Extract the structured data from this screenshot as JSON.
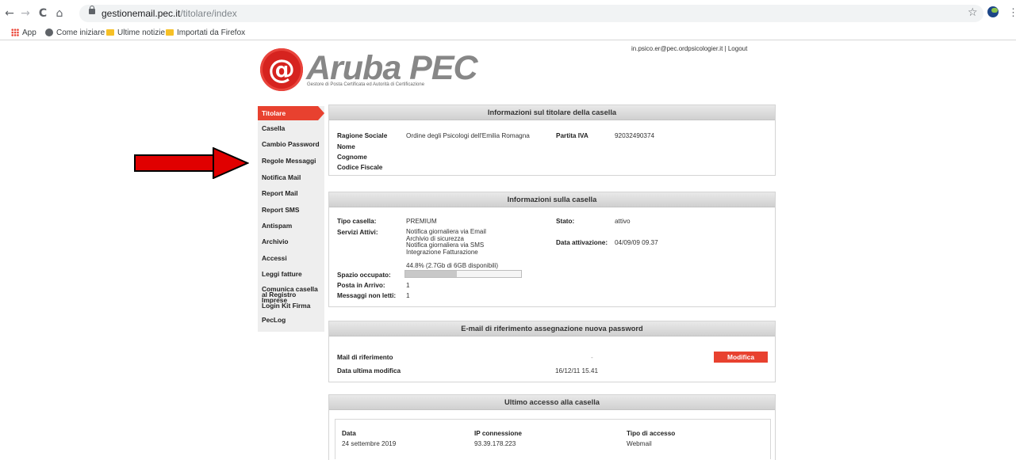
{
  "browser": {
    "url_host": "gestionemail.pec.it",
    "url_path": "/titolare/index",
    "bookmarks": [
      {
        "label": "App"
      },
      {
        "label": "Come iniziare"
      },
      {
        "label": "Ultime notizie"
      },
      {
        "label": "Importati da Firefox"
      }
    ],
    "nav_icons": {
      "back": "←",
      "forward": "→",
      "reload": "C",
      "home": "⌂",
      "star": "☆",
      "menu": "⋮"
    }
  },
  "header": {
    "logo_symbol": "@",
    "logo_name": "Aruba PEC",
    "logo_tagline": "Gestore di Posta Certificata ed Autorità di Certificazione",
    "user_email": "in.psico.er@pec.ordpsicologier.it",
    "separator": "|",
    "logout_label": "Logout"
  },
  "sidebar": {
    "active": "Titolare",
    "items": [
      "Casella",
      "Cambio Password",
      "Regole Messaggi",
      "Notifica Mail",
      "Report Mail",
      "Report SMS",
      "Antispam",
      "Archivio",
      "Accessi",
      "Leggi fatture",
      "Comunica casella al Registro Imprese",
      "Login Kit Firma",
      "PecLog"
    ]
  },
  "titolare": {
    "title": "Informazioni sul titolare della casella",
    "ragione_sociale_label": "Ragione Sociale",
    "ragione_sociale_value": "Ordine degli Psicologi dell'Emilia Romagna",
    "partita_iva_label": "Partita IVA",
    "partita_iva_value": "92032490374",
    "nome_label": "Nome",
    "cognome_label": "Cognome",
    "codice_fiscale_label": "Codice Fiscale"
  },
  "casella": {
    "title": "Informazioni sulla casella",
    "tipo_label": "Tipo casella:",
    "tipo_value": "PREMIUM",
    "stato_label": "Stato:",
    "stato_value": "attivo",
    "servizi_label": "Servizi Attivi:",
    "servizi": [
      "Notifica giornaliera via Email",
      "Archivio di sicurezza",
      "Notifica giornaliera via SMS",
      "Integrazione Fatturazione"
    ],
    "data_attivazione_label": "Data attivazione:",
    "data_attivazione_value": "04/09/09 09.37",
    "quota_text": "44.8% (2.7Gb di 6GB disponibili)",
    "quota_fraction": 0.448,
    "spazio_label": "Spazio occupato:",
    "posta_label": "Posta in Arrivo:",
    "posta_value": "1",
    "non_letti_label": "Messaggi non letti:",
    "non_letti_value": "1"
  },
  "email_rif": {
    "title": "E-mail di riferimento assegnazione nuova password",
    "mail_label": "Mail di riferimento",
    "mail_value": "-",
    "data_label": "Data ultima modifica",
    "data_value": "16/12/11 15.41",
    "button_label": "Modifica"
  },
  "accesso": {
    "title": "Ultimo accesso alla casella",
    "data_label": "Data",
    "data_value": "24 settembre 2019",
    "ip_label": "IP connessione",
    "ip_value": "93.39.178.223",
    "tipo_label": "Tipo di accesso",
    "tipo_value": "Webmail"
  },
  "colors": {
    "accent": "#e8412f",
    "arrow": "#e00000",
    "sidebar_bg": "#eeeeee"
  }
}
